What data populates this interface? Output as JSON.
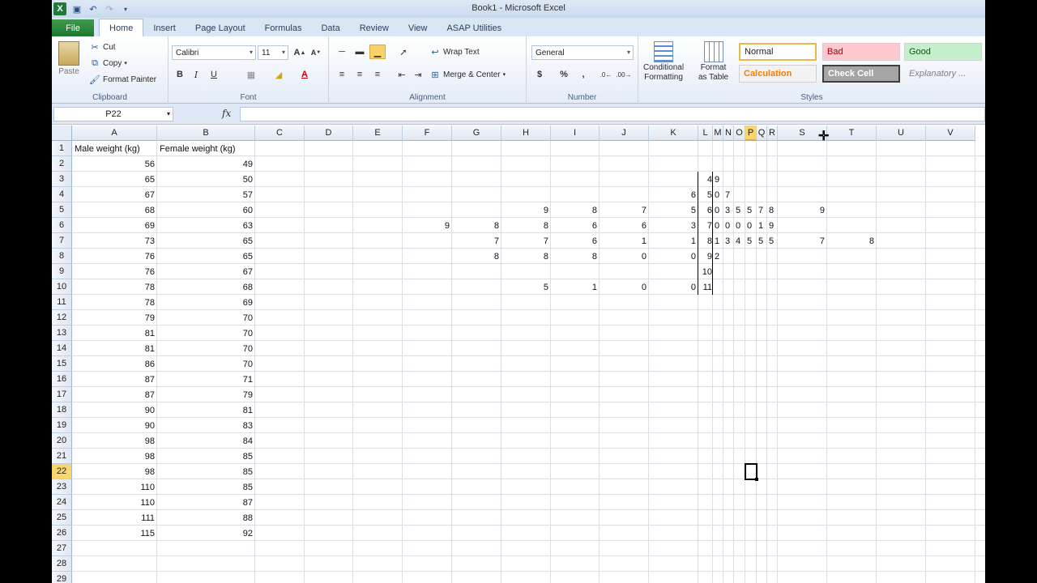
{
  "window": {
    "title": "Book1 - Microsoft Excel"
  },
  "tabs": [
    "File",
    "Home",
    "Insert",
    "Page Layout",
    "Formulas",
    "Data",
    "Review",
    "View",
    "ASAP Utilities"
  ],
  "active_tab": "Home",
  "ribbon": {
    "clipboard": {
      "label": "Clipboard",
      "paste": "Paste",
      "cut": "Cut",
      "copy": "Copy",
      "format_painter": "Format Painter"
    },
    "font": {
      "label": "Font",
      "font_name": "Calibri",
      "font_size": "11",
      "bold": "B",
      "italic": "I",
      "underline": "U"
    },
    "alignment": {
      "label": "Alignment",
      "wrap_text": "Wrap Text",
      "merge_center": "Merge & Center"
    },
    "number": {
      "label": "Number",
      "format": "General",
      "currency": "$",
      "percent": "%",
      "comma": ","
    },
    "styles": {
      "label": "Styles",
      "conditional_formatting": [
        "Conditional",
        "Formatting"
      ],
      "format_as_table": [
        "Format",
        "as Table"
      ],
      "cells": [
        "Normal",
        "Bad",
        "Good",
        "Calculation",
        "Check Cell",
        "Explanatory ..."
      ],
      "colors": {
        "bad_bg": "#ffc7ce",
        "bad_fg": "#9c0006",
        "good_bg": "#c6efce",
        "good_fg": "#006100",
        "calc_fg": "#fa7d00",
        "check_bg": "#a5a5a5"
      }
    }
  },
  "formula_bar": {
    "name_box": "P22",
    "fx": "fx",
    "value": ""
  },
  "sheet": {
    "columns": [
      "A",
      "B",
      "C",
      "D",
      "E",
      "F",
      "G",
      "H",
      "I",
      "J",
      "K",
      "L",
      "M",
      "N",
      "O",
      "P",
      "Q",
      "R",
      "S",
      "T",
      "U",
      "V"
    ],
    "selected_column": "P",
    "selected_row": 22,
    "rows": 29,
    "header_row": {
      "A": "Male weight (kg)",
      "B": "Female weight (kg)"
    },
    "male_weight": [
      56,
      65,
      67,
      68,
      69,
      73,
      76,
      76,
      78,
      78,
      79,
      81,
      81,
      86,
      87,
      87,
      90,
      90,
      98,
      98,
      98,
      110,
      110,
      111,
      115
    ],
    "female_weight": [
      49,
      50,
      57,
      60,
      63,
      65,
      65,
      67,
      68,
      69,
      70,
      70,
      70,
      70,
      71,
      79,
      81,
      83,
      84,
      85,
      85,
      85,
      87,
      88,
      92
    ],
    "stem_leaf": [
      {
        "row": 3,
        "K": "",
        "L": "4",
        "right": [
          "9"
        ]
      },
      {
        "row": 4,
        "K": "6",
        "L": "5",
        "right": [
          "0",
          "7"
        ]
      },
      {
        "row": 5,
        "K": "5",
        "L": "6",
        "right": [
          "0",
          "3",
          "5",
          "5",
          "7",
          "8"
        ]
      },
      {
        "row": 6,
        "K": "3",
        "L": "7",
        "right": [
          "0",
          "0",
          "0",
          "0",
          "1",
          "9"
        ]
      },
      {
        "row": 7,
        "K": "1",
        "L": "8",
        "right": [
          "1",
          "3",
          "4",
          "5",
          "5",
          "5"
        ]
      },
      {
        "row": 8,
        "K": "0",
        "L": "9",
        "right": [
          "2"
        ]
      },
      {
        "row": 9,
        "K": "",
        "L": "10",
        "right": []
      },
      {
        "row": 10,
        "K": "0",
        "L": "11",
        "right": []
      }
    ],
    "left_leaves": {
      "F": {
        "6": "9"
      },
      "G": {
        "6": "8",
        "7": "7",
        "8": "8"
      },
      "H": {
        "5": "9",
        "6": "8",
        "7": "7",
        "8": "8",
        "10": "5"
      },
      "I": {
        "5": "8",
        "6": "6",
        "7": "6",
        "8": "8",
        "10": "1"
      },
      "J": {
        "5": "7",
        "6": "6",
        "7": "1",
        "8": "0",
        "10": "0"
      }
    },
    "extra_right": [
      {
        "col": "S",
        "row": 5,
        "value": "9"
      },
      {
        "col": "S",
        "row": 7,
        "value": "7"
      },
      {
        "col": "T",
        "row": 7,
        "value": "8"
      }
    ]
  }
}
